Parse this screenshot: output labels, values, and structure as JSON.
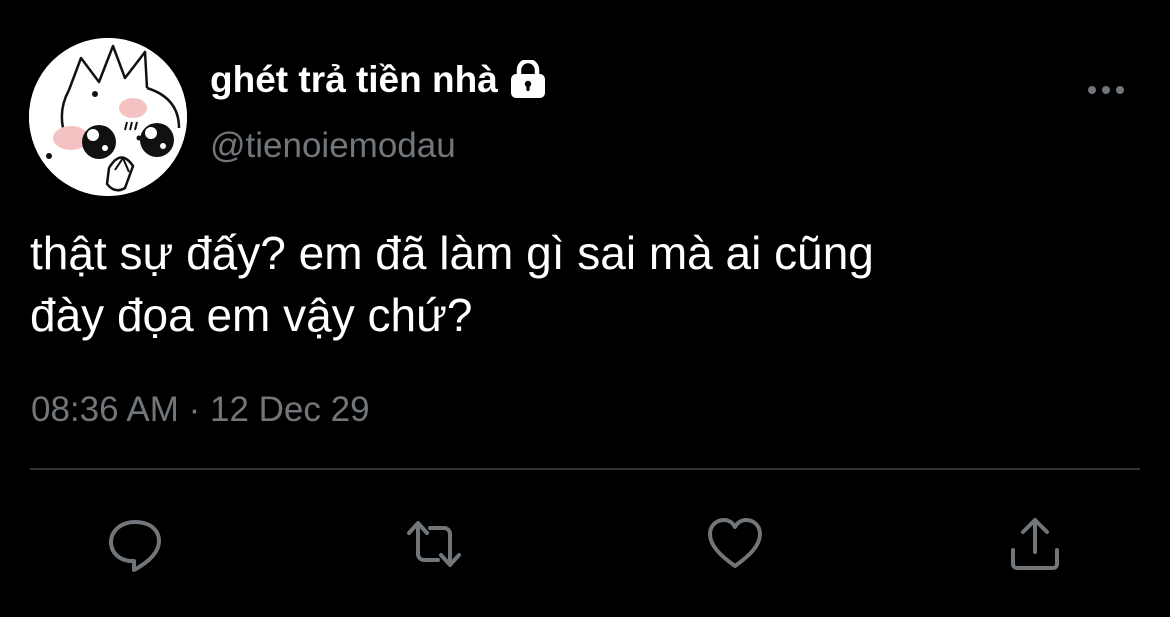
{
  "tweet": {
    "author": {
      "display_name": "ghét trả tiền nhà",
      "handle": "@tienoiemodau",
      "protected_icon": "lock-icon",
      "avatar": "cartoon-face-avatar"
    },
    "text_lines": [
      "thật sự đấy? em đã làm gì sai mà ai cũng",
      "đày đọa em vậy chứ?"
    ],
    "timestamp": "08:36 AM · 12 Dec 29",
    "actions": [
      {
        "name": "reply",
        "icon": "reply-icon"
      },
      {
        "name": "retweet",
        "icon": "retweet-icon"
      },
      {
        "name": "like",
        "icon": "heart-icon"
      },
      {
        "name": "share",
        "icon": "share-icon"
      }
    ],
    "more_icon": "more-icon"
  },
  "colors": {
    "background": "#000000",
    "primary_text": "#ffffff",
    "secondary_text": "#71767b",
    "divider": "#2f3336",
    "icon": "#71767b"
  }
}
